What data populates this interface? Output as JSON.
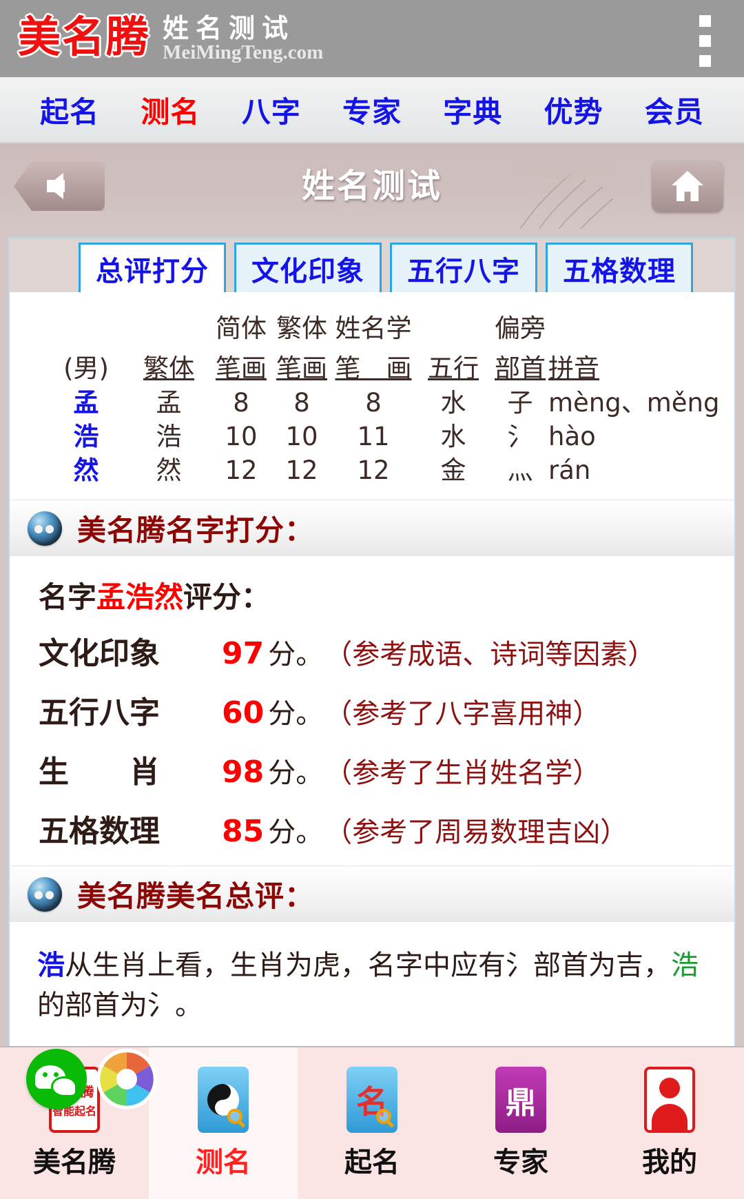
{
  "brand": {
    "logo_cn": "美名腾",
    "title_cn": "姓名测试",
    "domain": "MeiMingTeng.com",
    "menu_icon": "kebab-menu-icon"
  },
  "mainnav": {
    "items": [
      {
        "label": "起名",
        "active": false
      },
      {
        "label": "测名",
        "active": true
      },
      {
        "label": "八字",
        "active": false
      },
      {
        "label": "专家",
        "active": false
      },
      {
        "label": "字典",
        "active": false
      },
      {
        "label": "优势",
        "active": false
      },
      {
        "label": "会员",
        "active": false
      }
    ]
  },
  "titlebar": {
    "back_icon": "arrow-left-icon",
    "title": "姓名测试",
    "home_icon": "home-icon"
  },
  "tabs": [
    {
      "label": "总评打分",
      "active": true
    },
    {
      "label": "文化印象",
      "active": false
    },
    {
      "label": "五行八字",
      "active": false
    },
    {
      "label": "五格数理",
      "active": false
    }
  ],
  "char_table": {
    "top_headers": [
      "简体",
      "繁体",
      "姓名学",
      "偏旁"
    ],
    "headers": {
      "gender": "(男)",
      "fanti": "繁体",
      "jianti_bihua": "笔画",
      "fanti_bihua": "笔画",
      "xingmingxue_bihua": "笔　画",
      "wuxing": "五行",
      "bushou": "部首",
      "pinyin": "拼音"
    },
    "rows": [
      {
        "char": "孟",
        "fanti": "孟",
        "jianti": "8",
        "fantib": "8",
        "xmx": "8",
        "wuxing": "水",
        "bushou": "子",
        "pinyin": "mèng、měng"
      },
      {
        "char": "浩",
        "fanti": "浩",
        "jianti": "10",
        "fantib": "10",
        "xmx": "11",
        "wuxing": "水",
        "bushou": "氵",
        "pinyin": "hào"
      },
      {
        "char": "然",
        "fanti": "然",
        "jianti": "12",
        "fantib": "12",
        "xmx": "12",
        "wuxing": "金",
        "bushou": "灬",
        "pinyin": "rán"
      }
    ]
  },
  "score_section": {
    "heading": "美名腾名字打分：",
    "heading_icon": "yinyang-orb-icon",
    "title_prefix": "名字",
    "title_name": "孟浩然",
    "title_suffix": "评分：",
    "unit": "分。",
    "rows": [
      {
        "label": "文化印象",
        "score": "97",
        "note": "（参考成语、诗词等因素）"
      },
      {
        "label": "五行八字",
        "score": "60",
        "note": "（参考了八字喜用神）"
      },
      {
        "label": "生　　肖",
        "score": "98",
        "note": "（参考了生肖姓名学）"
      },
      {
        "label": "五格数理",
        "score": "85",
        "note": "（参考了周易数理吉凶）"
      }
    ]
  },
  "summary_section": {
    "heading": "美名腾美名总评：",
    "heading_icon": "yinyang-orb-icon",
    "paragraph": {
      "lead_char": "浩",
      "text_1": "从生肖上看，生肖为虎，名字中应有氵部首为吉，",
      "green_char": "浩",
      "text_2": "的部首为氵。"
    }
  },
  "floating_share": {
    "wechat_icon": "wechat-share-icon",
    "shutter_icon": "camera-shutter-icon"
  },
  "bottombar": {
    "items": [
      {
        "label": "美名腾",
        "icon": "meimingteng-seal-icon",
        "active": false,
        "seal_top": "美名腾",
        "seal_bottom": "智能起名"
      },
      {
        "label": "测名",
        "icon": "taiji-magnifier-icon",
        "active": true
      },
      {
        "label": "起名",
        "icon": "name-magnifier-icon",
        "active": false,
        "glyph": "名"
      },
      {
        "label": "专家",
        "icon": "expert-seal-icon",
        "active": false,
        "glyph": "鼎"
      },
      {
        "label": "我的",
        "icon": "user-avatar-icon",
        "active": false
      }
    ]
  },
  "colors": {
    "brand_red": "#ef1010",
    "nav_blue": "#1414e6",
    "active_red": "#ff0000",
    "tab_border": "#2ba6de",
    "heading_dark_red": "#8c0606",
    "note_red": "#8c1212",
    "bottombar_bg": "#fbe4e4"
  }
}
